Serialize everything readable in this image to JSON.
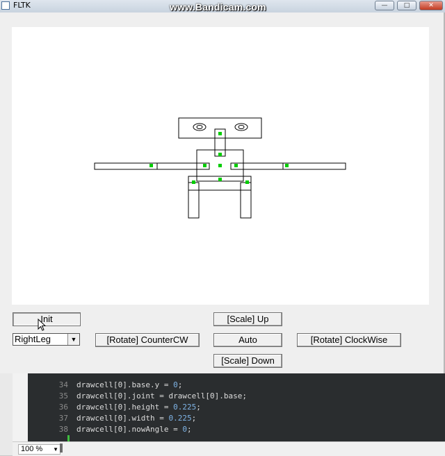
{
  "window": {
    "title": "FLTK",
    "watermark": "www.Bandicam.com"
  },
  "controls": {
    "init": "Init",
    "scale_up": "[Scale] Up",
    "select_value": "RightLeg",
    "rotate_ccw": "[Rotate] CounterCW",
    "auto": "Auto",
    "rotate_cw": "[Rotate] ClockWise",
    "scale_down": "[Scale] Down"
  },
  "editor": {
    "lines": [
      {
        "n": "34",
        "code": "drawcell[0].base.y = ",
        "val": "0",
        "end": ";"
      },
      {
        "n": "35",
        "code": "drawcell[0].joint = drawcell[0].base;",
        "val": "",
        "end": ""
      },
      {
        "n": "36",
        "code": "drawcell[0].height = ",
        "val": "0.225",
        "end": ";"
      },
      {
        "n": "37",
        "code": "drawcell[0].width = ",
        "val": "0.225",
        "end": ";"
      },
      {
        "n": "38",
        "code": "drawcell[0].nowAngle = ",
        "val": "0",
        "end": ";"
      }
    ]
  },
  "statusbar": {
    "zoom": "100 %"
  },
  "colors": {
    "joint": "#00cc00",
    "canvas": "#ffffff",
    "window_bg": "#efefef"
  },
  "icons": {
    "window_minimize": "minimize-icon",
    "window_maximize": "maximize-icon",
    "window_close": "close-icon"
  }
}
